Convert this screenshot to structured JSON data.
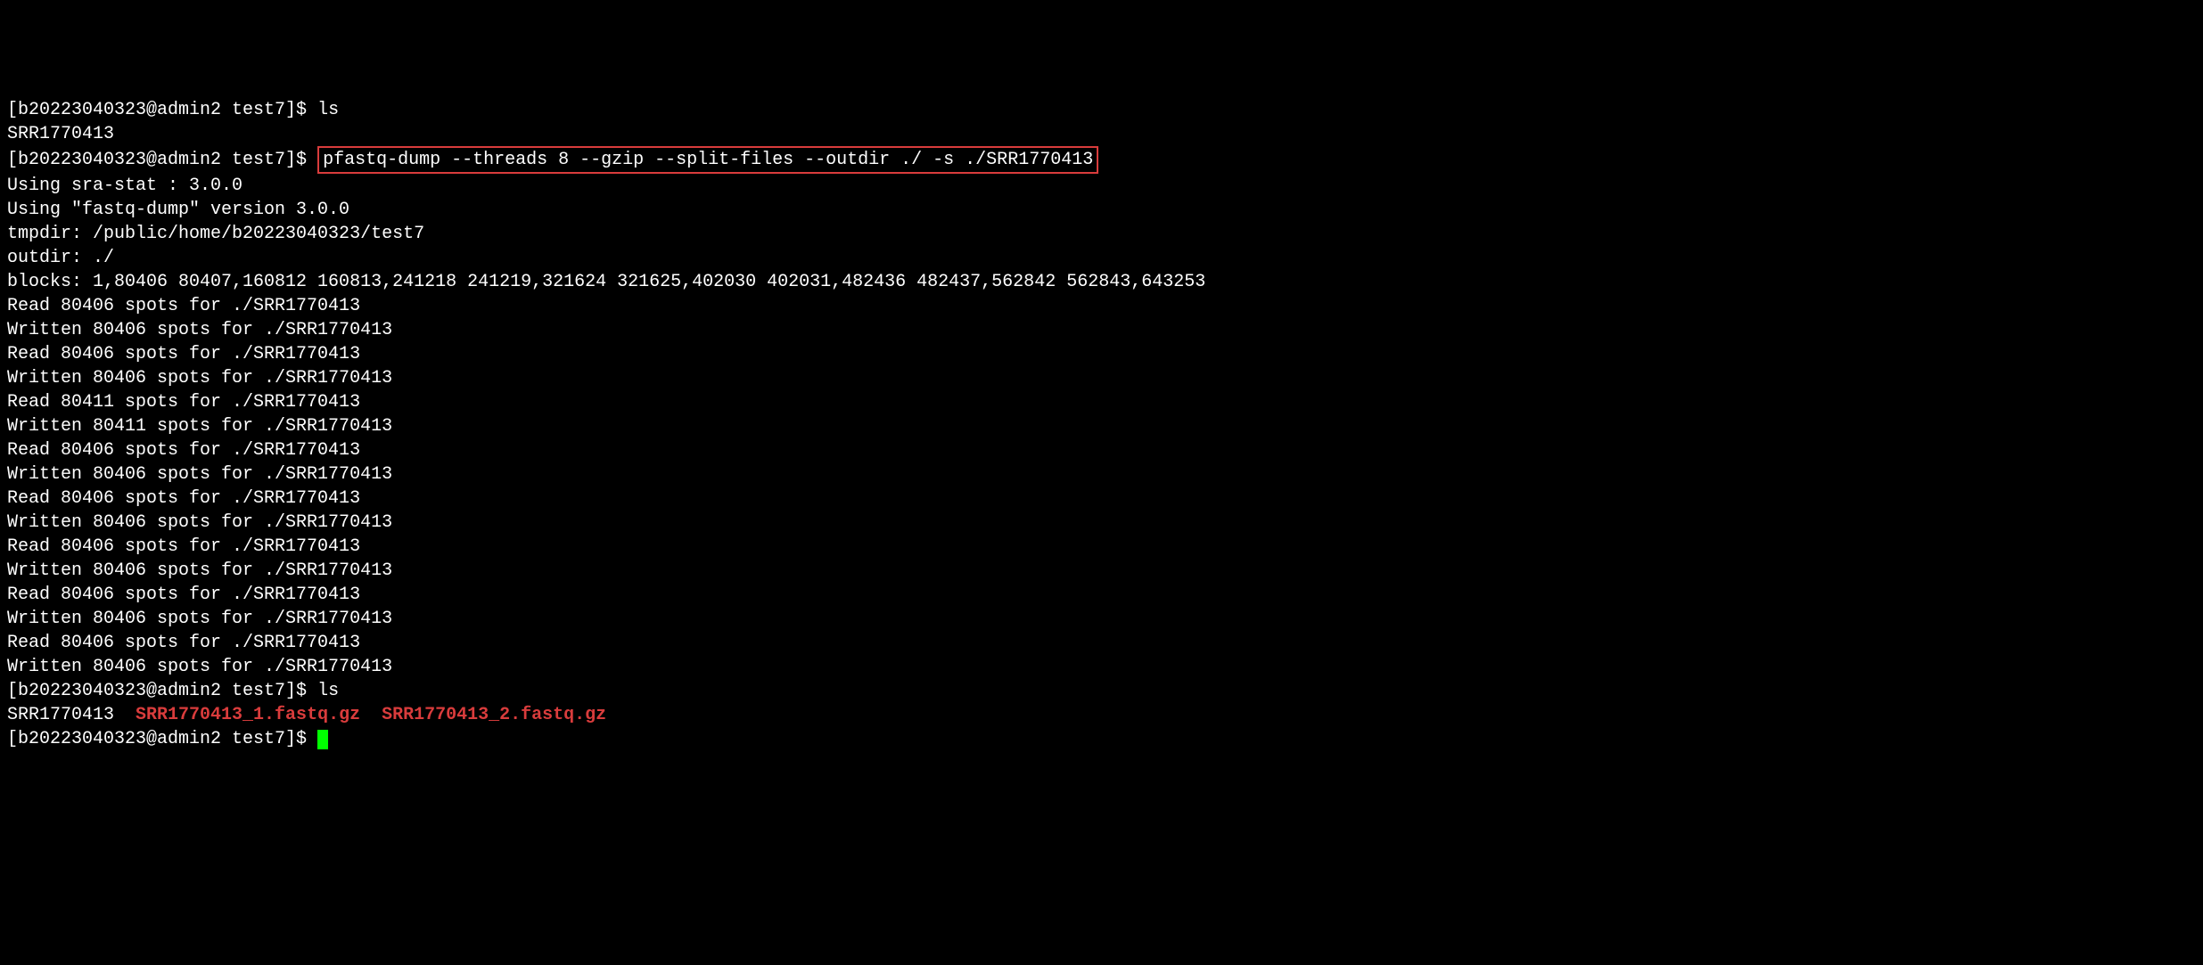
{
  "prompt1": "[b20223040323@admin2 test7]$ ",
  "cmd1": "ls",
  "out1": "SRR1770413",
  "prompt2": "[b20223040323@admin2 test7]$ ",
  "cmd2_highlighted": "pfastq-dump --threads 8 --gzip --split-files --outdir ./ -s ./SRR1770413",
  "out_lines": [
    "Using sra-stat : 3.0.0",
    "Using \"fastq-dump\" version 3.0.0",
    "tmpdir: /public/home/b20223040323/test7",
    "outdir: ./",
    "blocks: 1,80406 80407,160812 160813,241218 241219,321624 321625,402030 402031,482436 482437,562842 562843,643253",
    "Read 80406 spots for ./SRR1770413",
    "Written 80406 spots for ./SRR1770413",
    "Read 80406 spots for ./SRR1770413",
    "Written 80406 spots for ./SRR1770413",
    "Read 80411 spots for ./SRR1770413",
    "Written 80411 spots for ./SRR1770413",
    "Read 80406 spots for ./SRR1770413",
    "Written 80406 spots for ./SRR1770413",
    "Read 80406 spots for ./SRR1770413",
    "Written 80406 spots for ./SRR1770413",
    "Read 80406 spots for ./SRR1770413",
    "Written 80406 spots for ./SRR1770413",
    "Read 80406 spots for ./SRR1770413",
    "Written 80406 spots for ./SRR1770413",
    "Read 80406 spots for ./SRR1770413",
    "Written 80406 spots for ./SRR1770413"
  ],
  "prompt3": "[b20223040323@admin2 test7]$ ",
  "cmd3": "ls",
  "ls2_plain": "SRR1770413  ",
  "ls2_file1": "SRR1770413_1.fastq.gz",
  "ls2_sep": "  ",
  "ls2_file2": "SRR1770413_2.fastq.gz",
  "prompt4": "[b20223040323@admin2 test7]$ "
}
